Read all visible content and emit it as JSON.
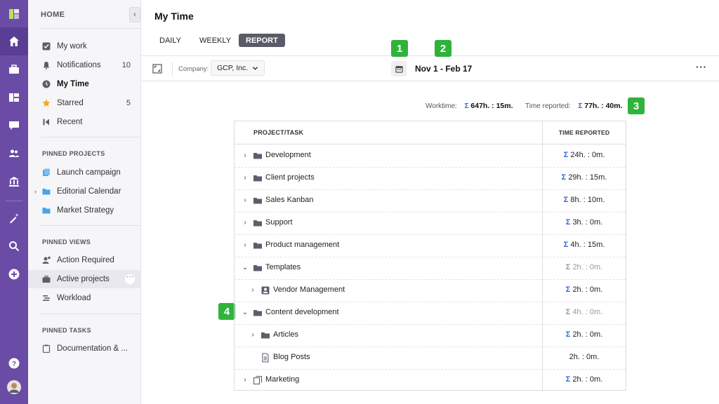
{
  "sidebar": {
    "header": "HOME",
    "collapse_glyph": "‹",
    "nav": [
      {
        "label": "My work",
        "count": "",
        "icon": "checkbox-icon"
      },
      {
        "label": "Notifications",
        "count": "10",
        "icon": "bell-icon"
      },
      {
        "label": "My Time",
        "count": "",
        "icon": "clock-icon"
      },
      {
        "label": "Starred",
        "count": "5",
        "icon": "star-icon"
      },
      {
        "label": "Recent",
        "count": "",
        "icon": "recent-icon"
      }
    ],
    "pinned_projects_title": "PINNED PROJECTS",
    "pinned_projects": [
      {
        "label": "Launch campaign"
      },
      {
        "label": "Editorial Calendar"
      },
      {
        "label": "Market Strategy"
      }
    ],
    "pinned_views_title": "PINNED VIEWS",
    "pinned_views": [
      {
        "label": "Action Required"
      },
      {
        "label": "Active projects"
      },
      {
        "label": "Workload"
      }
    ],
    "more_glyph": "···",
    "pinned_tasks_title": "PINNED TASKS",
    "pinned_tasks": [
      {
        "label": "Documentation & ..."
      }
    ]
  },
  "page": {
    "title": "My Time",
    "tabs": [
      "DAILY",
      "WEEKLY",
      "REPORT"
    ],
    "active_tab": "REPORT"
  },
  "toolbar": {
    "company_label": "Company:",
    "company_value": "GCP, Inc.",
    "date_range": "Nov 1 - Feb 17",
    "more": "···"
  },
  "badges": [
    "1",
    "2",
    "3",
    "4"
  ],
  "summary": {
    "worktime_label": "Worktime:",
    "worktime_value": "647h. : 15m.",
    "reported_label": "Time reported:",
    "reported_value": "77h. : 40m.",
    "sigma": "Σ"
  },
  "table": {
    "headers": [
      "PROJECT/TASK",
      "TIME REPORTED"
    ],
    "rows": [
      {
        "name": "Development",
        "time": "24h. : 0m.",
        "level": 0,
        "chevron": "›",
        "icon": "folder-icon",
        "sigma": "Σ"
      },
      {
        "name": "Client projects",
        "time": "29h. : 15m.",
        "level": 0,
        "chevron": "›",
        "icon": "folder-icon",
        "sigma": "Σ"
      },
      {
        "name": "Sales Kanban",
        "time": "8h. : 10m.",
        "level": 0,
        "chevron": "›",
        "icon": "folder-icon",
        "sigma": "Σ"
      },
      {
        "name": "Support",
        "time": "3h. : 0m.",
        "level": 0,
        "chevron": "›",
        "icon": "folder-icon",
        "sigma": "Σ"
      },
      {
        "name": "Product management",
        "time": "4h. : 15m.",
        "level": 0,
        "chevron": "›",
        "icon": "folder-icon",
        "sigma": "Σ"
      },
      {
        "name": "Templates",
        "time": "2h. : 0m.",
        "level": 0,
        "chevron": "⌄",
        "icon": "folder-icon",
        "sigma": "Σ"
      },
      {
        "name": "Vendor Management",
        "time": "2h. : 0m.",
        "level": 1,
        "chevron": "›",
        "icon": "contact-card-icon",
        "sigma": "Σ"
      },
      {
        "name": "Content development",
        "time": "4h. : 0m.",
        "level": 0,
        "chevron": "⌄",
        "icon": "folder-icon",
        "sigma": "Σ"
      },
      {
        "name": "Articles",
        "time": "2h. : 0m.",
        "level": 1,
        "chevron": "›",
        "icon": "folder-icon",
        "sigma": "Σ"
      },
      {
        "name": "Blog Posts",
        "time": "2h. : 0m.",
        "level": 1,
        "chevron": "",
        "icon": "document-icon",
        "sigma": ""
      },
      {
        "name": "Marketing",
        "time": "2h. : 0m.",
        "level": 0,
        "chevron": "›",
        "icon": "copy-icon",
        "sigma": "Σ"
      }
    ]
  }
}
